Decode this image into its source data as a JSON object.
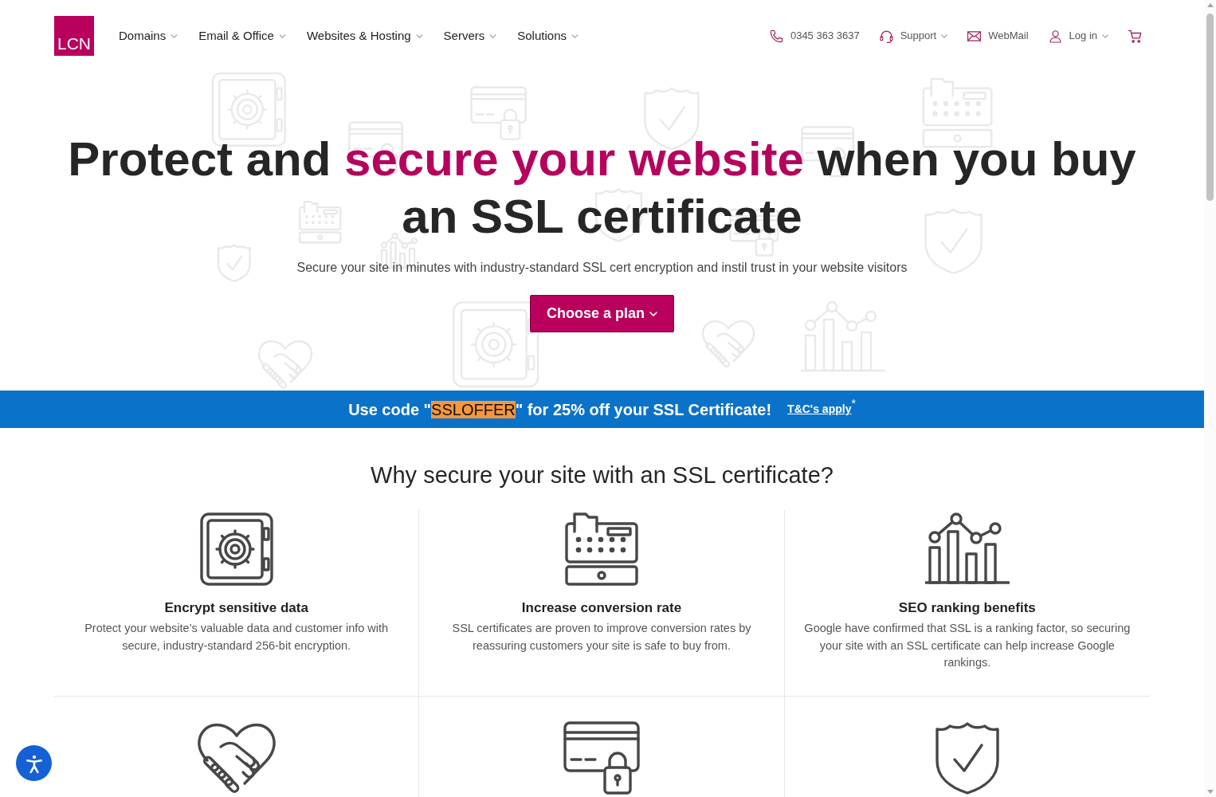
{
  "header": {
    "logo": "LCN",
    "nav": [
      {
        "label": "Domains",
        "has_menu": true
      },
      {
        "label": "Email & Office",
        "has_menu": true
      },
      {
        "label": "Websites & Hosting",
        "has_menu": true
      },
      {
        "label": "Servers",
        "has_menu": true
      },
      {
        "label": "Solutions",
        "has_menu": true
      }
    ],
    "utility": [
      {
        "label": "0345 363 3637",
        "has_menu": false
      },
      {
        "label": "Support",
        "has_menu": true
      },
      {
        "label": "WebMail",
        "has_menu": false
      },
      {
        "label": "Log in",
        "has_menu": true
      }
    ]
  },
  "hero": {
    "title": "Protect and **secure your website** when you buy an SSL certificate",
    "subtitle": "Secure your site in minutes with industry-standard SSL cert encryption and instil trust in your website visitors",
    "button": "Choose a plan"
  },
  "promo": {
    "before": "Use code \"",
    "code": "SSLOFFER",
    "after": "\" for 25% off your SSL Certificate!",
    "link": "T&C's apply",
    "mark": "*"
  },
  "why": {
    "heading": "Why secure your site with an SSL certificate?",
    "features": [
      {
        "title": "Encrypt sensitive data",
        "description": "Protect your website’s valuable data and customer info with secure, industry-standard 256-bit encryption."
      },
      {
        "title": "Increase conversion rate",
        "description": "SSL certificates are proven to improve conversion rates by reassuring customers your site is safe to buy from."
      },
      {
        "title": "SEO ranking benefits",
        "description": "Google have confirmed that SSL is a ranking factor, so securing your site with an SSL certificate can help increase Google rankings."
      }
    ]
  }
}
